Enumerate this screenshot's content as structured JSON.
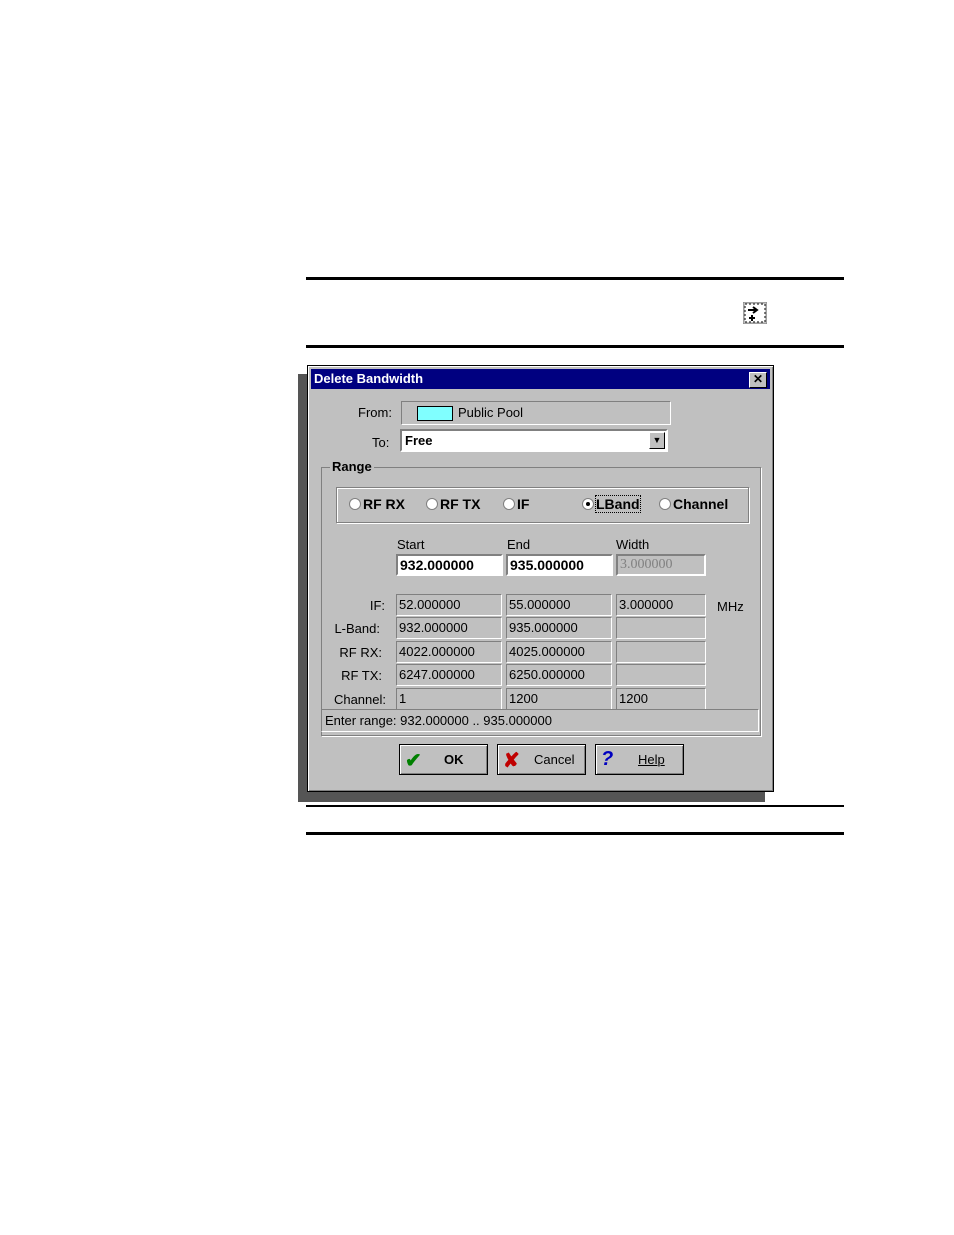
{
  "icons": {
    "toolbar": "delete-bandwidth-icon"
  },
  "dialog": {
    "title": "Delete Bandwidth",
    "close": "✕",
    "from_label": "From:",
    "from_value": "Public Pool",
    "from_color": "#80ffff",
    "to_label": "To:",
    "to_value": "Free",
    "range_title": "Range",
    "radios": [
      {
        "label": "RF RX",
        "selected": false
      },
      {
        "label": "RF TX",
        "selected": false
      },
      {
        "label": "IF",
        "selected": false
      },
      {
        "label": "LBand",
        "selected": true
      },
      {
        "label": "Channel",
        "selected": false
      }
    ],
    "columns": {
      "start": "Start",
      "end": "End",
      "width": "Width"
    },
    "inputs": {
      "start": "932.000000",
      "end": "935.000000",
      "width": "3.000000"
    },
    "rows": [
      {
        "label": "IF:",
        "start": "52.000000",
        "end": "55.000000",
        "width": "3.000000"
      },
      {
        "label": "L-Band:",
        "start": "932.000000",
        "end": "935.000000",
        "width": ""
      },
      {
        "label": "RF RX:",
        "start": "4022.000000",
        "end": "4025.000000",
        "width": ""
      },
      {
        "label": "RF TX:",
        "start": "6247.000000",
        "end": "6250.000000",
        "width": ""
      },
      {
        "label": "Channel:",
        "start": "1",
        "end": "1200",
        "width": "1200"
      }
    ],
    "unit": "MHz",
    "status": "Enter range:  932.000000 .. 935.000000",
    "buttons": {
      "ok": "OK",
      "cancel": "Cancel",
      "help": "Help"
    }
  }
}
